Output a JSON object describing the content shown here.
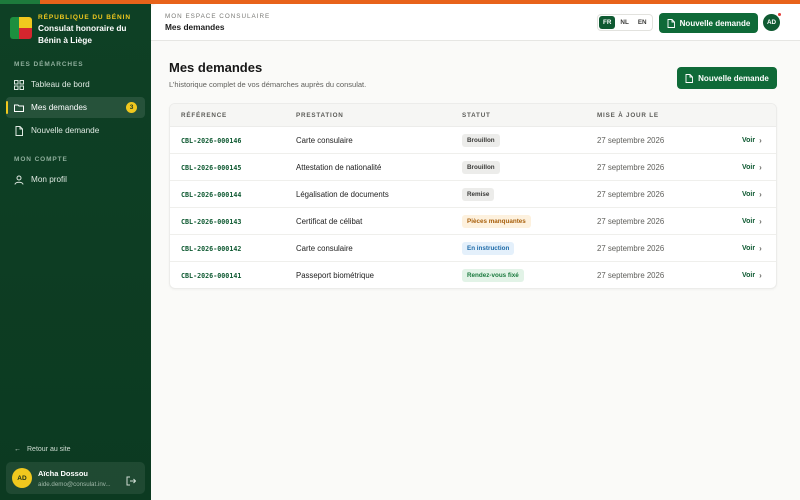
{
  "brand": {
    "kicker": "RÉPUBLIQUE DU BÉNIN",
    "title": "Consulat honoraire du Bénin à Liège"
  },
  "sidebar": {
    "section1": "MES DÉMARCHES",
    "section2": "MON COMPTE",
    "items": [
      {
        "label": "Tableau de bord",
        "icon": "dashboard-icon"
      },
      {
        "label": "Mes demandes",
        "icon": "folder-icon",
        "badge": "3"
      },
      {
        "label": "Nouvelle demande",
        "icon": "document-icon"
      },
      {
        "label": "Mon profil",
        "icon": "user-icon"
      }
    ],
    "back_label": "Retour au site",
    "user": {
      "initials": "AD",
      "name": "Aïcha Dossou",
      "email": "aide.demo@consulat.inv..."
    }
  },
  "header": {
    "kicker": "MON ESPACE CONSULAIRE",
    "title": "Mes demandes",
    "languages": [
      "FR",
      "NL",
      "EN"
    ],
    "active_language": "FR",
    "new_request_label": "Nouvelle demande",
    "avatar_initials": "AD"
  },
  "page": {
    "title": "Mes demandes",
    "subtitle": "L’historique complet de vos démarches auprès du consulat.",
    "new_request_label": "Nouvelle demande"
  },
  "table": {
    "columns": [
      "RÉFÉRENCE",
      "PRESTATION",
      "STATUT",
      "MISE À JOUR LE"
    ],
    "action_label": "Voir",
    "rows": [
      {
        "ref": "CBL-2026-000146",
        "service": "Carte consulaire",
        "status": "Brouillon",
        "tone": "grey",
        "date": "27 septembre 2026"
      },
      {
        "ref": "CBL-2026-000145",
        "service": "Attestation de nationalité",
        "status": "Brouillon",
        "tone": "grey",
        "date": "27 septembre 2026"
      },
      {
        "ref": "CBL-2026-000144",
        "service": "Légalisation de documents",
        "status": "Remise",
        "tone": "grey",
        "date": "27 septembre 2026"
      },
      {
        "ref": "CBL-2026-000143",
        "service": "Certificat de célibat",
        "status": "Pièces manquantes",
        "tone": "amber",
        "date": "27 septembre 2026"
      },
      {
        "ref": "CBL-2026-000142",
        "service": "Carte consulaire",
        "status": "En instruction",
        "tone": "blue",
        "date": "27 septembre 2026"
      },
      {
        "ref": "CBL-2026-000141",
        "service": "Passeport biométrique",
        "status": "Rendez-vous fixé",
        "tone": "green",
        "date": "27 septembre 2026"
      }
    ]
  },
  "colors": {
    "primary": "#0f6a38",
    "sidebar": "#0e4025",
    "accent": "#f0c81e",
    "stripe": "#e8631a"
  }
}
